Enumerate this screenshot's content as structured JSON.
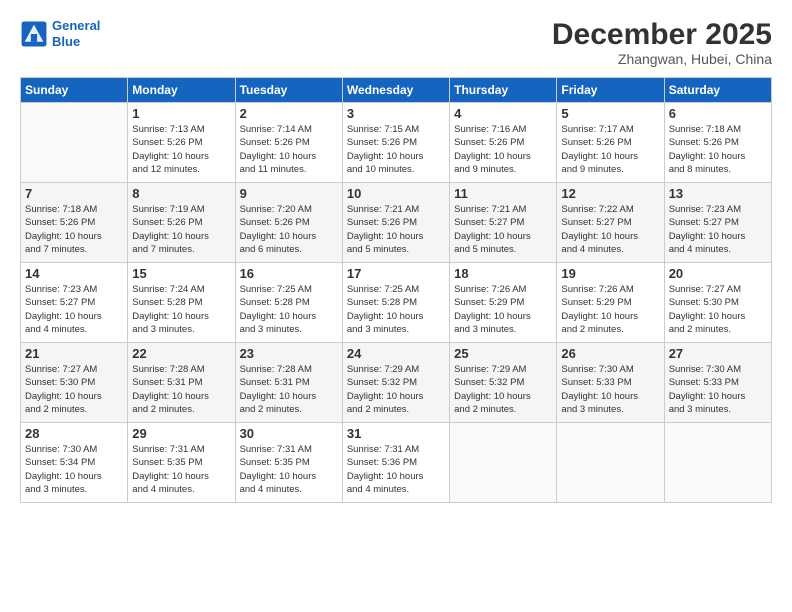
{
  "header": {
    "logo_line1": "General",
    "logo_line2": "Blue",
    "month": "December 2025",
    "location": "Zhangwan, Hubei, China"
  },
  "columns": [
    "Sunday",
    "Monday",
    "Tuesday",
    "Wednesday",
    "Thursday",
    "Friday",
    "Saturday"
  ],
  "weeks": [
    [
      {
        "day": "",
        "info": ""
      },
      {
        "day": "1",
        "info": "Sunrise: 7:13 AM\nSunset: 5:26 PM\nDaylight: 10 hours\nand 12 minutes."
      },
      {
        "day": "2",
        "info": "Sunrise: 7:14 AM\nSunset: 5:26 PM\nDaylight: 10 hours\nand 11 minutes."
      },
      {
        "day": "3",
        "info": "Sunrise: 7:15 AM\nSunset: 5:26 PM\nDaylight: 10 hours\nand 10 minutes."
      },
      {
        "day": "4",
        "info": "Sunrise: 7:16 AM\nSunset: 5:26 PM\nDaylight: 10 hours\nand 9 minutes."
      },
      {
        "day": "5",
        "info": "Sunrise: 7:17 AM\nSunset: 5:26 PM\nDaylight: 10 hours\nand 9 minutes."
      },
      {
        "day": "6",
        "info": "Sunrise: 7:18 AM\nSunset: 5:26 PM\nDaylight: 10 hours\nand 8 minutes."
      }
    ],
    [
      {
        "day": "7",
        "info": "Sunrise: 7:18 AM\nSunset: 5:26 PM\nDaylight: 10 hours\nand 7 minutes."
      },
      {
        "day": "8",
        "info": "Sunrise: 7:19 AM\nSunset: 5:26 PM\nDaylight: 10 hours\nand 7 minutes."
      },
      {
        "day": "9",
        "info": "Sunrise: 7:20 AM\nSunset: 5:26 PM\nDaylight: 10 hours\nand 6 minutes."
      },
      {
        "day": "10",
        "info": "Sunrise: 7:21 AM\nSunset: 5:26 PM\nDaylight: 10 hours\nand 5 minutes."
      },
      {
        "day": "11",
        "info": "Sunrise: 7:21 AM\nSunset: 5:27 PM\nDaylight: 10 hours\nand 5 minutes."
      },
      {
        "day": "12",
        "info": "Sunrise: 7:22 AM\nSunset: 5:27 PM\nDaylight: 10 hours\nand 4 minutes."
      },
      {
        "day": "13",
        "info": "Sunrise: 7:23 AM\nSunset: 5:27 PM\nDaylight: 10 hours\nand 4 minutes."
      }
    ],
    [
      {
        "day": "14",
        "info": "Sunrise: 7:23 AM\nSunset: 5:27 PM\nDaylight: 10 hours\nand 4 minutes."
      },
      {
        "day": "15",
        "info": "Sunrise: 7:24 AM\nSunset: 5:28 PM\nDaylight: 10 hours\nand 3 minutes."
      },
      {
        "day": "16",
        "info": "Sunrise: 7:25 AM\nSunset: 5:28 PM\nDaylight: 10 hours\nand 3 minutes."
      },
      {
        "day": "17",
        "info": "Sunrise: 7:25 AM\nSunset: 5:28 PM\nDaylight: 10 hours\nand 3 minutes."
      },
      {
        "day": "18",
        "info": "Sunrise: 7:26 AM\nSunset: 5:29 PM\nDaylight: 10 hours\nand 3 minutes."
      },
      {
        "day": "19",
        "info": "Sunrise: 7:26 AM\nSunset: 5:29 PM\nDaylight: 10 hours\nand 2 minutes."
      },
      {
        "day": "20",
        "info": "Sunrise: 7:27 AM\nSunset: 5:30 PM\nDaylight: 10 hours\nand 2 minutes."
      }
    ],
    [
      {
        "day": "21",
        "info": "Sunrise: 7:27 AM\nSunset: 5:30 PM\nDaylight: 10 hours\nand 2 minutes."
      },
      {
        "day": "22",
        "info": "Sunrise: 7:28 AM\nSunset: 5:31 PM\nDaylight: 10 hours\nand 2 minutes."
      },
      {
        "day": "23",
        "info": "Sunrise: 7:28 AM\nSunset: 5:31 PM\nDaylight: 10 hours\nand 2 minutes."
      },
      {
        "day": "24",
        "info": "Sunrise: 7:29 AM\nSunset: 5:32 PM\nDaylight: 10 hours\nand 2 minutes."
      },
      {
        "day": "25",
        "info": "Sunrise: 7:29 AM\nSunset: 5:32 PM\nDaylight: 10 hours\nand 2 minutes."
      },
      {
        "day": "26",
        "info": "Sunrise: 7:30 AM\nSunset: 5:33 PM\nDaylight: 10 hours\nand 3 minutes."
      },
      {
        "day": "27",
        "info": "Sunrise: 7:30 AM\nSunset: 5:33 PM\nDaylight: 10 hours\nand 3 minutes."
      }
    ],
    [
      {
        "day": "28",
        "info": "Sunrise: 7:30 AM\nSunset: 5:34 PM\nDaylight: 10 hours\nand 3 minutes."
      },
      {
        "day": "29",
        "info": "Sunrise: 7:31 AM\nSunset: 5:35 PM\nDaylight: 10 hours\nand 4 minutes."
      },
      {
        "day": "30",
        "info": "Sunrise: 7:31 AM\nSunset: 5:35 PM\nDaylight: 10 hours\nand 4 minutes."
      },
      {
        "day": "31",
        "info": "Sunrise: 7:31 AM\nSunset: 5:36 PM\nDaylight: 10 hours\nand 4 minutes."
      },
      {
        "day": "",
        "info": ""
      },
      {
        "day": "",
        "info": ""
      },
      {
        "day": "",
        "info": ""
      }
    ]
  ]
}
